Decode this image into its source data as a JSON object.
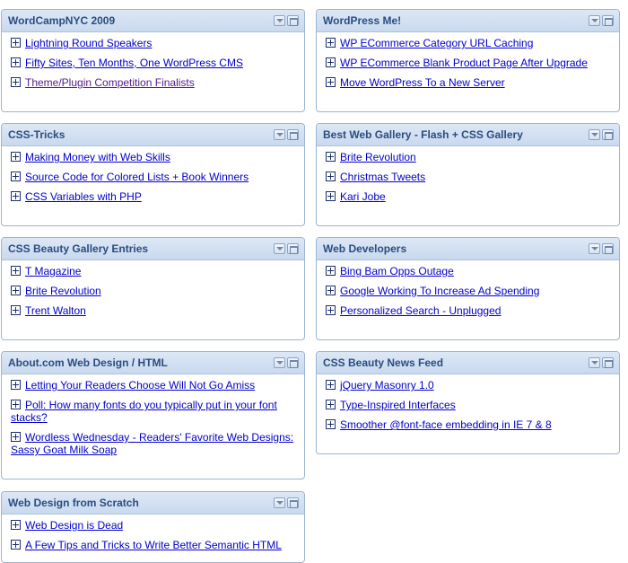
{
  "left": [
    {
      "title": "WordCampNYC 2009",
      "items": [
        {
          "label": "Lightning Round Speakers"
        },
        {
          "label": "Fifty Sites, Ten Months, One WordPress CMS"
        },
        {
          "label": "Theme/Plugin Competition Finalists",
          "visited": true
        }
      ]
    },
    {
      "title": "CSS-Tricks",
      "items": [
        {
          "label": "Making Money with Web Skills"
        },
        {
          "label": "Source Code for Colored Lists + Book Winners"
        },
        {
          "label": "CSS Variables with PHP"
        }
      ]
    },
    {
      "title": "CSS Beauty Gallery Entries",
      "items": [
        {
          "label": "T Magazine"
        },
        {
          "label": "Brite Revolution"
        },
        {
          "label": "Trent Walton"
        }
      ]
    },
    {
      "title": "About.com Web Design / HTML",
      "items": [
        {
          "label": "Letting Your Readers Choose Will Not Go Amiss"
        },
        {
          "label": "Poll: How many fonts do you typically put in your font stacks?"
        },
        {
          "label": "Wordless Wednesday - Readers' Favorite Web Designs: Sassy Goat Milk Soap"
        }
      ]
    },
    {
      "title": "Web Design from Scratch",
      "items": [
        {
          "label": "Web Design is Dead"
        },
        {
          "label": "A Few Tips and Tricks to Write Better Semantic HTML"
        }
      ]
    }
  ],
  "right": [
    {
      "title": "WordPress Me!",
      "items": [
        {
          "label": "WP ECommerce Category URL Caching"
        },
        {
          "label": "WP ECommerce Blank Product Page After Upgrade"
        },
        {
          "label": "Move WordPress To a New Server"
        }
      ]
    },
    {
      "title": "Best Web Gallery - Flash + CSS Gallery",
      "items": [
        {
          "label": "Brite Revolution"
        },
        {
          "label": "Christmas Tweets"
        },
        {
          "label": "Kari Jobe"
        }
      ]
    },
    {
      "title": "Web Developers",
      "items": [
        {
          "label": "Bing Bam Opps Outage"
        },
        {
          "label": "Google Working To Increase Ad Spending"
        },
        {
          "label": "Personalized Search - Unplugged"
        }
      ]
    },
    {
      "title": "CSS Beauty News Feed",
      "items": [
        {
          "label": "jQuery Masonry 1.0"
        },
        {
          "label": "Type-Inspired Interfaces"
        },
        {
          "label": "Smoother @font-face embedding in IE 7 & 8"
        }
      ]
    }
  ],
  "icons": {
    "expand": "plus-box-icon",
    "minimize": "minimize-arrow-icon",
    "maximize": "maximize-window-icon"
  },
  "colors": {
    "header_bg": "#cfdcf0",
    "border": "#9db4d0",
    "title_text": "#2b4c80",
    "link": "#0000cc",
    "visited_link": "#551a8b"
  }
}
